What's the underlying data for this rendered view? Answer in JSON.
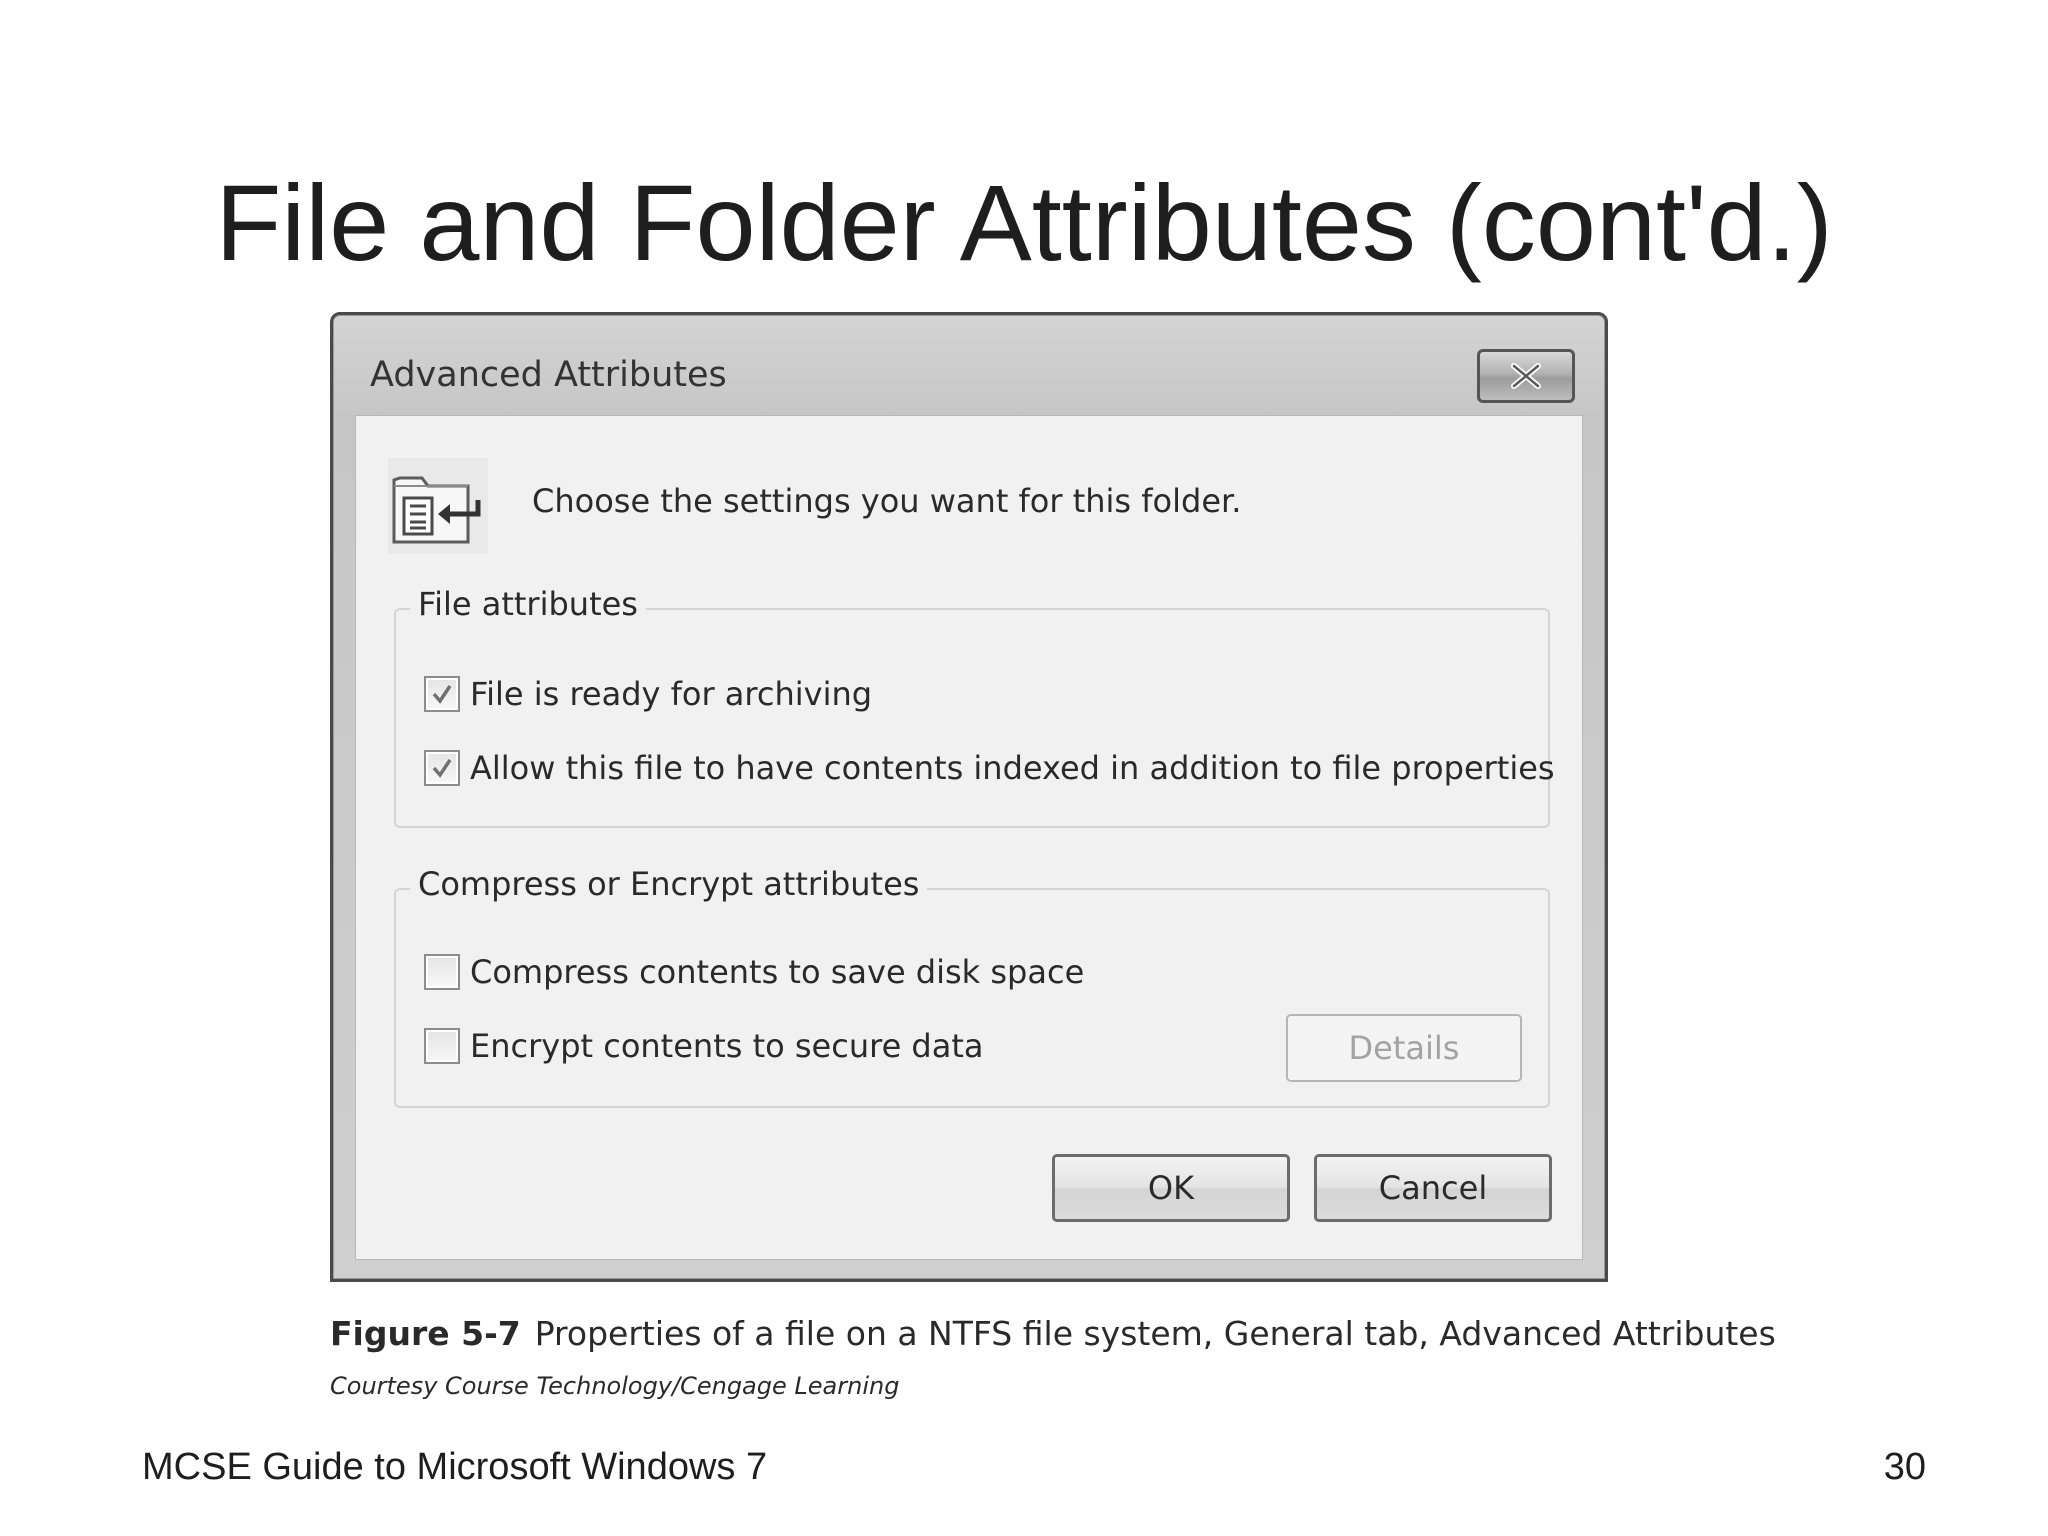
{
  "slide": {
    "title": "File and Folder Attributes (cont'd.)",
    "footer_text": "MCSE Guide to Microsoft Windows 7",
    "page_number": "30"
  },
  "dialog": {
    "title": "Advanced Attributes",
    "instruction": "Choose the settings you want for this folder.",
    "icon": "folder-attributes-icon",
    "file_attributes": {
      "legend": "File attributes",
      "options": [
        {
          "label": "File is ready for archiving",
          "checked": true
        },
        {
          "label": "Allow this file to have contents indexed in addition to file properties",
          "checked": true
        }
      ]
    },
    "compress_encrypt": {
      "legend": "Compress or Encrypt attributes",
      "options": [
        {
          "label": "Compress contents to save disk space",
          "checked": false
        },
        {
          "label": "Encrypt contents to secure data",
          "checked": false
        }
      ],
      "details_label": "Details",
      "details_enabled": false
    },
    "buttons": {
      "ok_label": "OK",
      "cancel_label": "Cancel"
    }
  },
  "caption": {
    "figure_number": "Figure 5-7",
    "figure_text": "Properties of a file on a NTFS file system, General tab, Advanced Attributes",
    "credit": "Courtesy Course Technology/Cengage Learning"
  }
}
